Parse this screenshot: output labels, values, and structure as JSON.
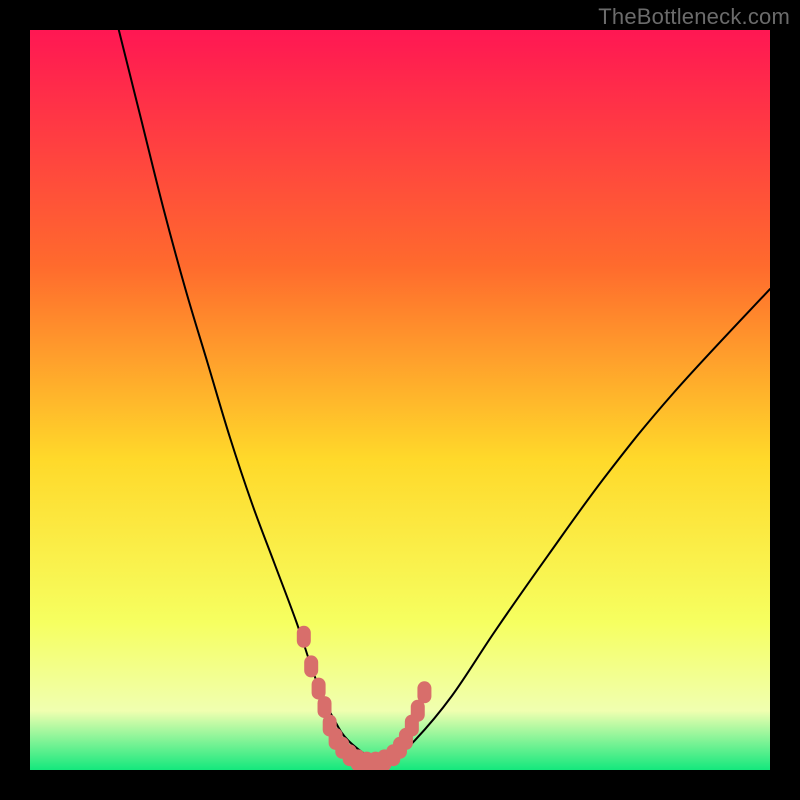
{
  "watermark": "TheBottleneck.com",
  "icons": {
    "none": ""
  },
  "chart_data": {
    "type": "line",
    "title": "",
    "xlabel": "",
    "ylabel": "",
    "xlim": [
      0,
      100
    ],
    "ylim": [
      0,
      100
    ],
    "grid": false,
    "legend": false,
    "series": [
      {
        "name": "bottleneck-curve",
        "x": [
          12,
          15,
          18,
          21,
          24,
          27,
          30,
          33,
          36,
          38,
          39.5,
          41,
          43,
          47,
          48.5,
          52,
          57,
          63,
          70,
          78,
          87,
          100
        ],
        "y": [
          100,
          88,
          76,
          65,
          55,
          45,
          36,
          28,
          20,
          14,
          10,
          7,
          4,
          1,
          1,
          4,
          10,
          19,
          29,
          40,
          51,
          65
        ]
      }
    ],
    "markers": [
      {
        "name": "optimal-band",
        "color": "#d86e6b",
        "points": [
          {
            "x": 37.0,
            "y": 18.0
          },
          {
            "x": 38.0,
            "y": 14.0
          },
          {
            "x": 39.0,
            "y": 11.0
          },
          {
            "x": 39.8,
            "y": 8.5
          },
          {
            "x": 40.5,
            "y": 6.0
          },
          {
            "x": 41.3,
            "y": 4.2
          },
          {
            "x": 42.2,
            "y": 3.0
          },
          {
            "x": 43.2,
            "y": 2.0
          },
          {
            "x": 44.3,
            "y": 1.3
          },
          {
            "x": 45.5,
            "y": 1.0
          },
          {
            "x": 46.7,
            "y": 1.0
          },
          {
            "x": 47.9,
            "y": 1.3
          },
          {
            "x": 49.1,
            "y": 2.0
          },
          {
            "x": 50.0,
            "y": 3.0
          },
          {
            "x": 50.8,
            "y": 4.2
          },
          {
            "x": 51.6,
            "y": 6.0
          },
          {
            "x": 52.4,
            "y": 8.0
          },
          {
            "x": 53.3,
            "y": 10.5
          }
        ]
      }
    ],
    "background_gradient": {
      "top": "#ff1753",
      "q1": "#ff6b2d",
      "mid": "#ffd92a",
      "q3": "#f6ff60",
      "low": "#f0ffb0",
      "bottom": "#14e87d"
    }
  }
}
